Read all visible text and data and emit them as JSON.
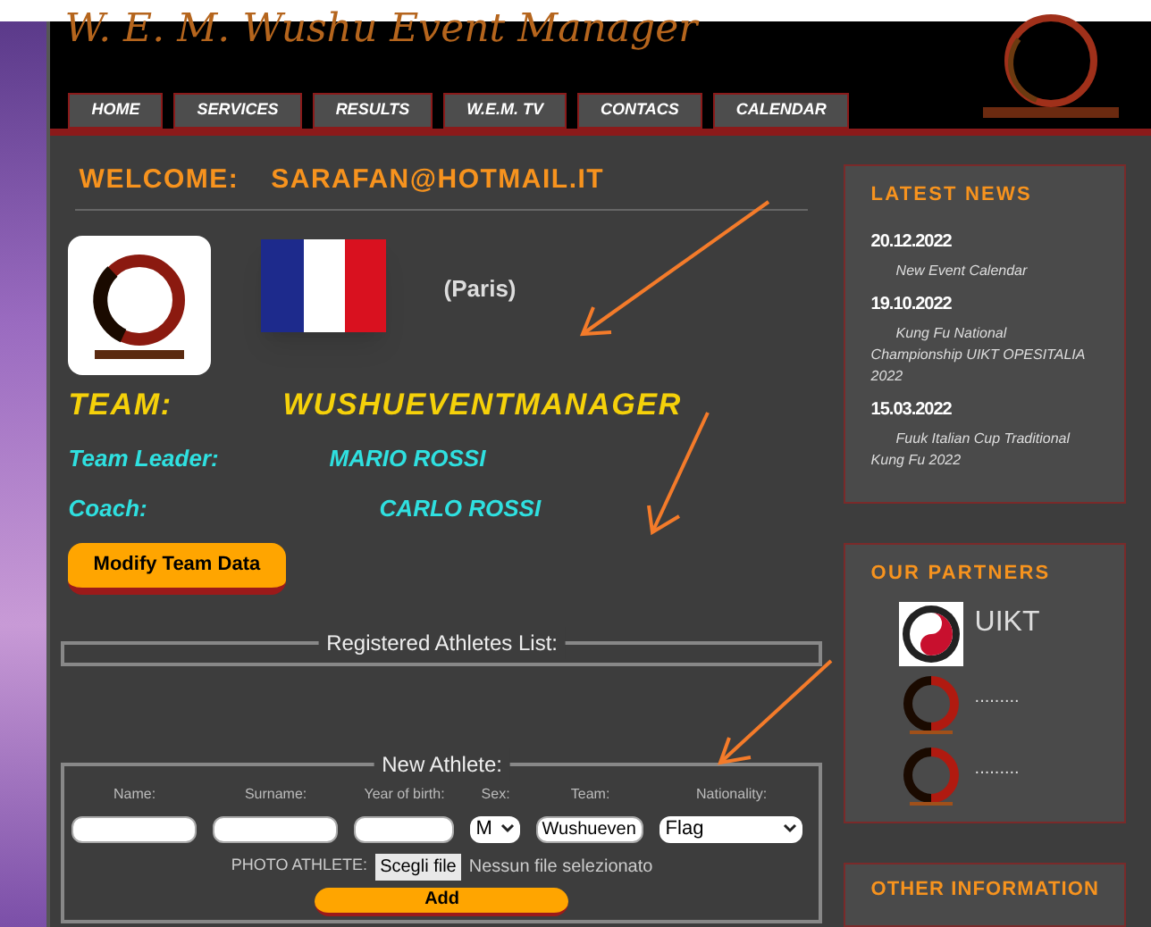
{
  "header": {
    "title": "W. E. M. Wushu Event Manager"
  },
  "nav": [
    {
      "label": "HOME"
    },
    {
      "label": "SERVICES"
    },
    {
      "label": "RESULTS"
    },
    {
      "label": "W.E.M. TV"
    },
    {
      "label": "CONTACS"
    },
    {
      "label": "CALENDAR"
    }
  ],
  "welcome": {
    "label": "WELCOME:",
    "email": "SARAFAN@HOTMAIL.IT"
  },
  "team": {
    "city": "(Paris)",
    "team_label": "TEAM:",
    "team_name": "WUSHUEVENTMANAGER",
    "leader_label": "Team Leader:",
    "leader": "MARIO ROSSI",
    "coach_label": "Coach:",
    "coach": "CARLO ROSSI",
    "modify_button": "Modify Team Data"
  },
  "registered": {
    "legend": "Registered Athletes List:"
  },
  "new_athlete": {
    "legend": "New Athlete:",
    "columns": [
      "Name:",
      "Surname:",
      "Year of birth:",
      "Sex:",
      "Team:",
      "Nationality:"
    ],
    "fields": [
      {
        "kind": "text"
      },
      {
        "kind": "text"
      },
      {
        "kind": "text"
      },
      {
        "kind": "select",
        "value": "M"
      },
      {
        "kind": "text",
        "value": "Wushueven"
      },
      {
        "kind": "select",
        "value": "Flag"
      }
    ],
    "photo_label": "PHOTO ATHLETE:",
    "file_button": "Scegli file",
    "file_status": "Nessun file selezionato",
    "add_button": "Add"
  },
  "news": {
    "title": "LATEST NEWS",
    "items": [
      {
        "date": "20.12.2022",
        "text": "New Event Calendar"
      },
      {
        "date": "19.10.2022",
        "text": "Kung Fu National Championship UIKT OPESITALIA 2022"
      },
      {
        "date": "15.03.2022",
        "text": "Fuuk Italian Cup Traditional Kung Fu 2022"
      }
    ]
  },
  "partners": {
    "title": "OUR PARTNERS",
    "items": [
      {
        "kind": "uikt",
        "label": "UIKT"
      },
      {
        "kind": "wem",
        "label": "........."
      },
      {
        "kind": "wem",
        "label": "........."
      }
    ]
  },
  "other": {
    "title": "OTHER INFORMATION"
  }
}
